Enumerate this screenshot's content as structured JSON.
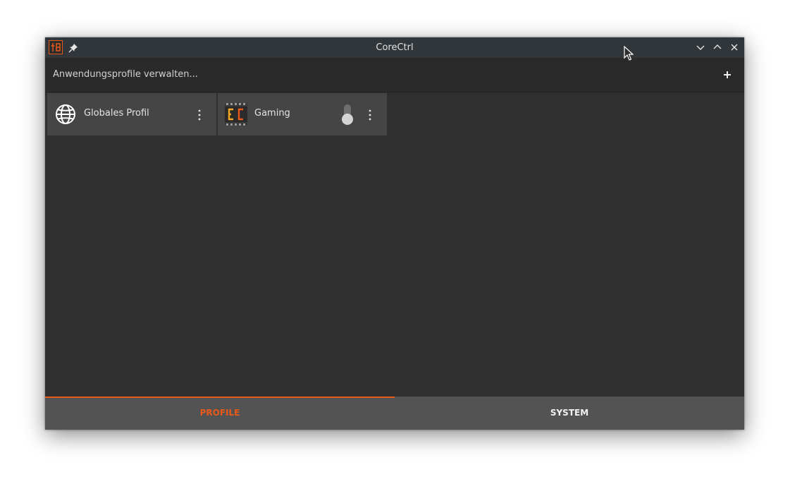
{
  "window": {
    "title": "CoreCtrl"
  },
  "toolbar": {
    "manage_profiles_label": "Anwendungsprofile verwalten...",
    "add_icon": "plus-icon"
  },
  "profiles": [
    {
      "label": "Globales Profil",
      "icon": "globe-icon",
      "has_toggle": false
    },
    {
      "label": "Gaming",
      "icon": "corectrl-logo-icon",
      "has_toggle": true,
      "enabled": false
    }
  ],
  "tabs": [
    {
      "label": "PROFILE",
      "active": true
    },
    {
      "label": "SYSTEM",
      "active": false
    }
  ],
  "colors": {
    "accent": "#e8591a",
    "window_bg": "#2f2f2f",
    "titlebar_bg": "#31363b",
    "card_bg": "#454545",
    "tabbar_bg": "#535353"
  }
}
